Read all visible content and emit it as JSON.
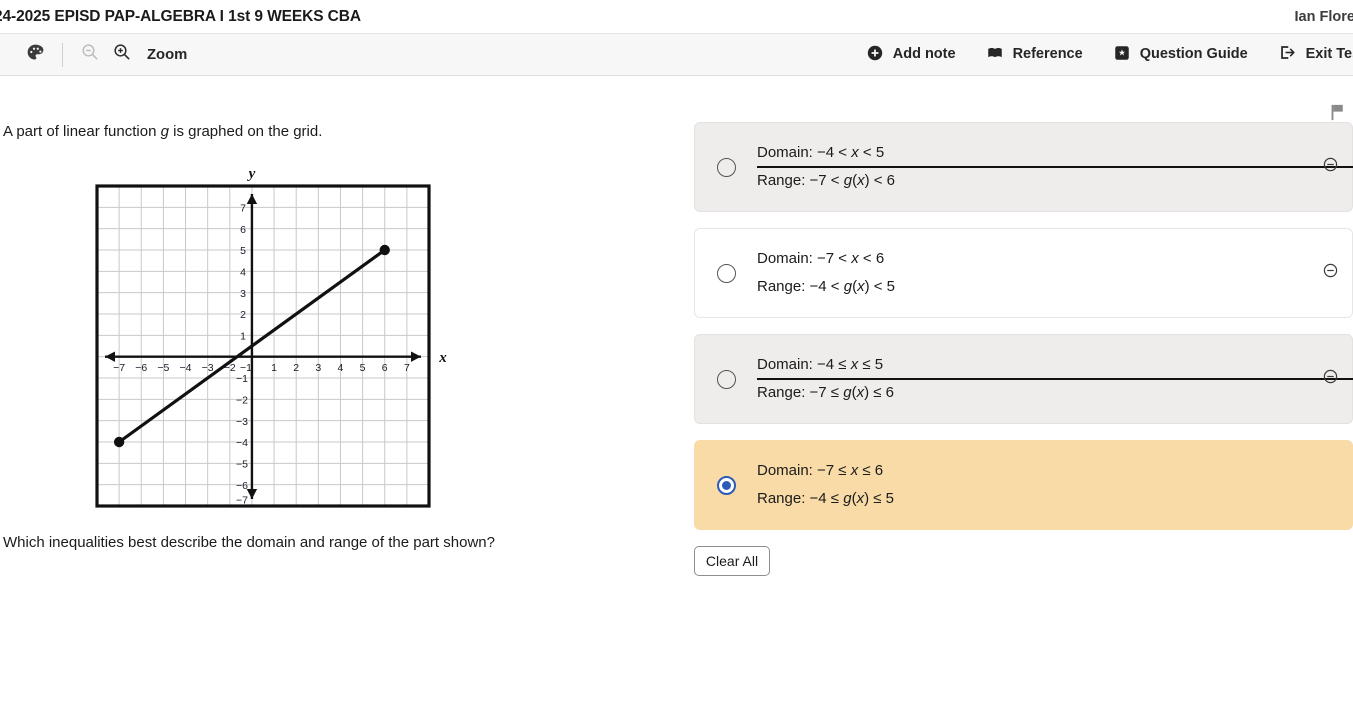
{
  "header": {
    "test_title": "24-2025 EPISD PAP-ALGEBRA I 1st 9 WEEKS CBA",
    "user_name": "Ian Flores"
  },
  "toolbar": {
    "palette_icon": "palette-icon",
    "zoom_out_icon": "zoom-out-icon",
    "zoom_in_icon": "zoom-in-icon",
    "zoom_label": "Zoom",
    "items": [
      {
        "label": "Add note",
        "icon": "plus-circle-icon"
      },
      {
        "label": "Reference",
        "icon": "book-icon"
      },
      {
        "label": "Question Guide",
        "icon": "guide-icon"
      },
      {
        "label": "Exit Test",
        "icon": "exit-icon"
      }
    ]
  },
  "question": {
    "flag_icon": "flag-icon",
    "stem_prefix": "A part of linear function ",
    "stem_var": "g",
    "stem_suffix": " is graphed on the grid.",
    "prompt": "Which inequalities best describe the domain and range of the part shown?"
  },
  "chart_data": {
    "type": "line",
    "title": "",
    "xlabel": "x",
    "ylabel": "y",
    "xlim": [
      -7.8,
      7.8
    ],
    "ylim": [
      -7.8,
      7.8
    ],
    "xticks": [
      -7,
      -6,
      -5,
      -4,
      -3,
      -2,
      -1,
      1,
      2,
      3,
      4,
      5,
      6,
      7
    ],
    "yticks": [
      -7,
      -6,
      -5,
      -4,
      -3,
      -2,
      -1,
      1,
      2,
      3,
      4,
      5,
      6,
      7
    ],
    "grid": true,
    "legend": "none",
    "series": [
      {
        "name": "g",
        "type": "segment",
        "points": [
          [
            -7,
            -4
          ],
          [
            6,
            5
          ]
        ],
        "endpoints": "closed",
        "color": "#111111"
      }
    ],
    "annotations": [
      {
        "text": "y",
        "position": "top-axis"
      },
      {
        "text": "x",
        "position": "right-axis"
      }
    ]
  },
  "answers": {
    "options": [
      {
        "id": "A",
        "domain": "Domain: −4 < x < 5",
        "domain_pre": "Domain: −4 < ",
        "domain_var": "x",
        "domain_post": " < 5",
        "range_pre": "Range: −7 < ",
        "range_var": "g",
        "range_mid": "(",
        "range_var2": "x",
        "range_post": ") < 6",
        "state": "eliminated",
        "selected": false,
        "eliminate_icon": "minus-circle-icon"
      },
      {
        "id": "B",
        "domain_pre": "Domain: −7 < ",
        "domain_var": "x",
        "domain_post": " < 6",
        "range_pre": "Range: −4 < ",
        "range_var": "g",
        "range_mid": "(",
        "range_var2": "x",
        "range_post": ") < 5",
        "state": "normal",
        "selected": false,
        "eliminate_icon": "minus-circle-icon"
      },
      {
        "id": "C",
        "domain_pre": "Domain: −4 ≤ ",
        "domain_var": "x",
        "domain_post": " ≤ 5",
        "range_pre": "Range: −7 ≤ ",
        "range_var": "g",
        "range_mid": "(",
        "range_var2": "x",
        "range_post": ") ≤ 6",
        "state": "eliminated",
        "selected": false,
        "eliminate_icon": "minus-circle-icon"
      },
      {
        "id": "D",
        "domain_pre": "Domain: −7 ≤ ",
        "domain_var": "x",
        "domain_post": " ≤ 6",
        "range_pre": "Range: −4 ≤ ",
        "range_var": "g",
        "range_mid": "(",
        "range_var2": "x",
        "range_post": ") ≤ 5",
        "state": "selected",
        "selected": true,
        "eliminate_icon": "minus-circle-icon"
      }
    ],
    "clear_all_label": "Clear All"
  },
  "colors": {
    "selected_bg": "#f8dba6",
    "eliminated_bg": "#efedec",
    "radio_selected": "#2a5cb8",
    "toolbar_bg": "#f7f7f7",
    "grid_line": "#c9c9c9",
    "axis": "#111111"
  }
}
